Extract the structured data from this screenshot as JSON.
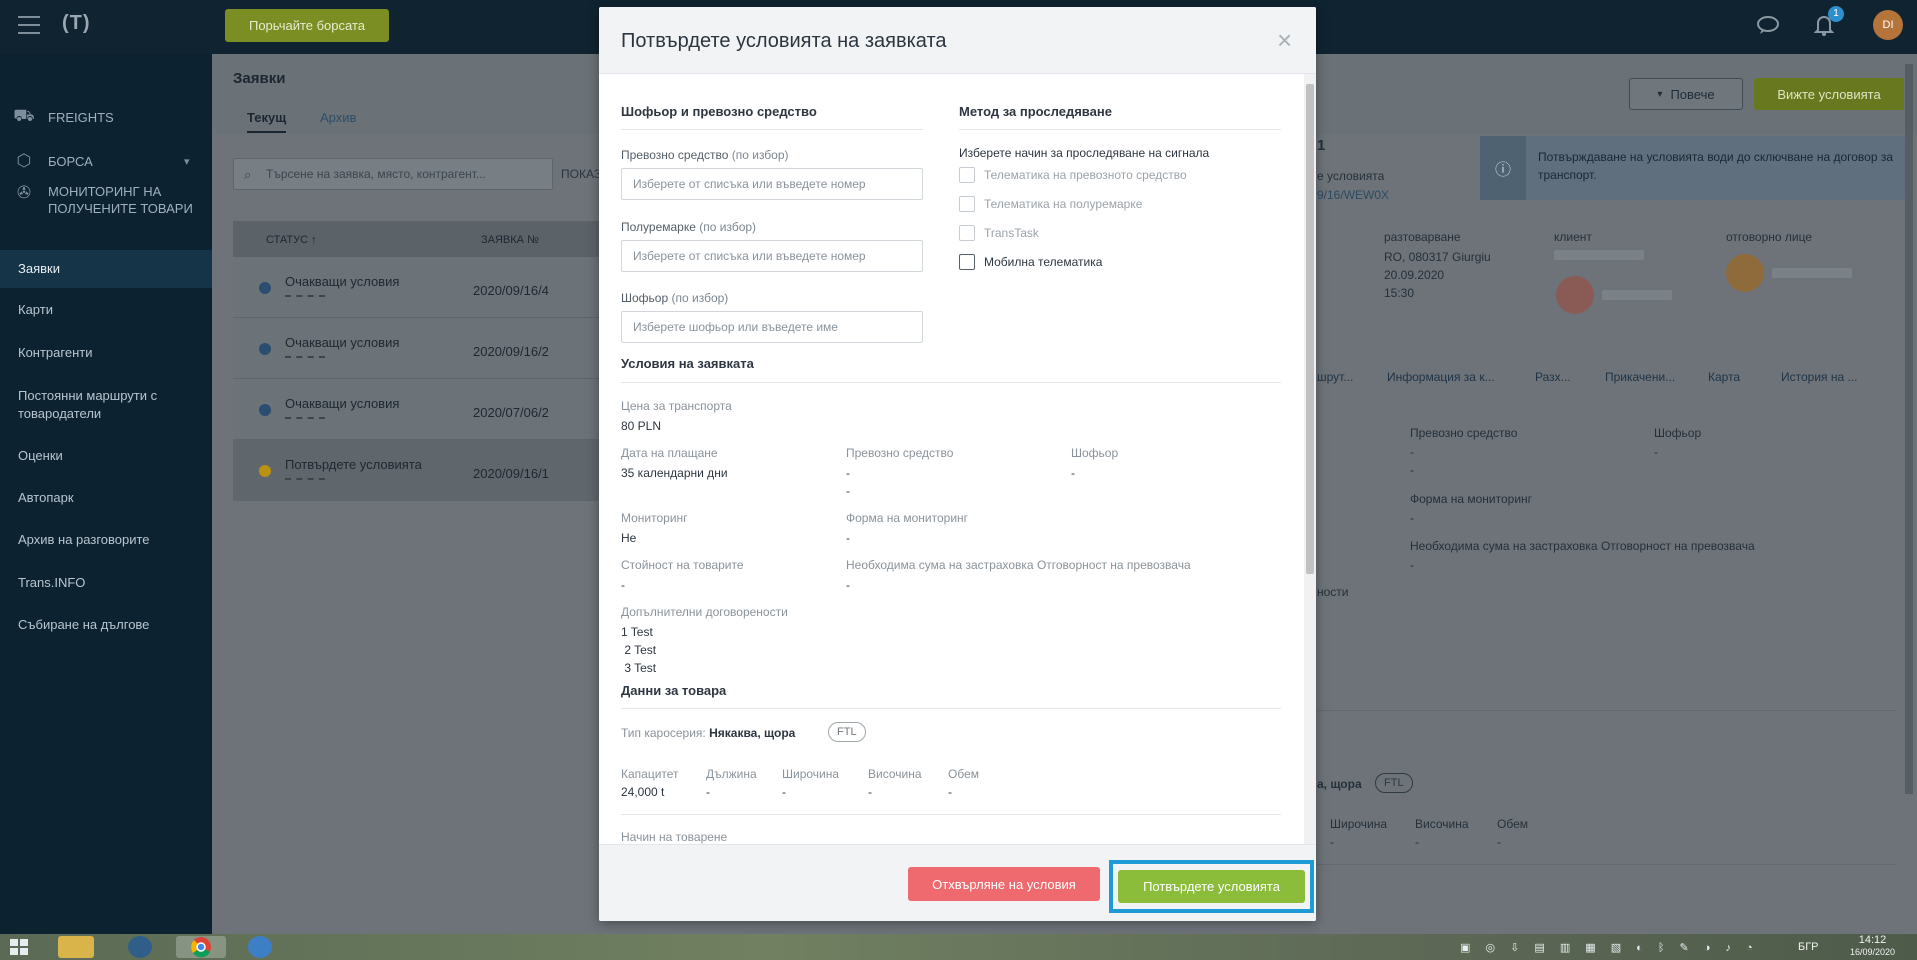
{
  "topbar": {
    "buy_label": "Порьчайте борсата",
    "notification_count": "1",
    "avatar_initials": "DI"
  },
  "sidebar": {
    "top_items": [
      {
        "label": "FREIGHTS",
        "icon": "freights-icon"
      },
      {
        "label": "БОРСА",
        "icon": "box-icon"
      },
      {
        "label": "МОНИТОРИНГ НА ПОЛУЧЕНИТЕ ТОВАРИ",
        "icon": "monitoring-icon"
      }
    ],
    "items": [
      {
        "label": "Заявки",
        "active": true
      },
      {
        "label": "Карти"
      },
      {
        "label": "Контрагенти"
      },
      {
        "label": "Постоянни маршрути с товародатели"
      },
      {
        "label": "Оценки"
      },
      {
        "label": "Автопарк"
      },
      {
        "label": "Архив на разговорите"
      },
      {
        "label": "Trans.INFO"
      },
      {
        "label": "Събиране на дългове"
      }
    ]
  },
  "main": {
    "title": "Заявки",
    "tabs": [
      "Текущ",
      "Архив"
    ],
    "search_placeholder": "Търсене на заявка, място, контрагент...",
    "show_label": "ПОКАЗ",
    "columns": [
      "СТАТУС ↑",
      "ЗАЯВКА №"
    ],
    "rows": [
      {
        "status": "Очакващи условия",
        "number": "2020/09/16/4"
      },
      {
        "status": "Очакващи условия",
        "number": "2020/09/16/2"
      },
      {
        "status": "Очакващи условия",
        "number": "2020/07/06/2"
      },
      {
        "status": "Потвърдете условията",
        "number": "2020/09/16/1"
      }
    ],
    "more_label": "Повече",
    "view_label": "Вижте условията",
    "info_text": "Потвърждаване на условията води до сключване на договор за транспорт.",
    "detail_id": "1",
    "detail_status": "е условията",
    "detail_ref": "9/16/WEW0X",
    "col_unloading": "разтоварване",
    "unloading_place": "RO, 080317 Giurgiu",
    "unloading_date": "20.09.2020",
    "unloading_time": "15:30",
    "col_client": "клиент",
    "col_responsible": "отговорно лице",
    "detail_tabs": [
      "шрут...",
      "Информация за к...",
      "Разх...",
      "Прикачени...",
      "Карта",
      "История на ..."
    ],
    "bg_vehicle": "Превозно средство",
    "bg_driver": "Шофьор",
    "bg_form": "Форма на мониторинг",
    "bg_insurance": "Необходима сума на застраховка Отговорност на превозвача",
    "bg_nosti": "ности",
    "bg_body": "а, щора",
    "bg_ftl": "FTL",
    "bg_dims": [
      "Широчина",
      "Височина",
      "Обем"
    ],
    "dash": "-"
  },
  "modal": {
    "title": "Потвърдете условията на заявката",
    "driver_section": "Шофьор и превозно средство",
    "vehicle_label": "Превозно средство",
    "trailer_label": "Полуремарке",
    "driver_label": "Шофьор",
    "optional": "(по избор)",
    "vehicle_placeholder": "Изберете от списъка или въведете номер",
    "trailer_placeholder": "Изберете от списъка или въведете номер",
    "driver_placeholder": "Изберете шофьор или въведете име",
    "tracking_section": "Метод за проследяване",
    "tracking_hint": "Изберете начин за проследяване на сигнала",
    "tracking_options": [
      "Телематика на превозното средство",
      "Телематика на полуремарке",
      "TransTask",
      "Мобилна телематика"
    ],
    "conditions_section": "Условия на заявката",
    "price_label": "Цена за транспорта",
    "price_value": "80 PLN",
    "pay_label": "Дата на плащане",
    "pay_value": "35 календарни дни",
    "vehicle2_label": "Превозно средство",
    "driver2_label": "Шофьор",
    "monitoring_label": "Мониторинг",
    "monitoring_value": "Не",
    "monitoring_form_label": "Форма на мониторинг",
    "goods_value_label": "Стойност на товарите",
    "insurance_label": "Необходима сума на застраховка Отговорност на превозвача",
    "extra_label": "Допълнителни договорености",
    "extra_lines": [
      "1 Test",
      " 2 Test",
      " 3 Test"
    ],
    "goods_section": "Данни за товара",
    "body_type_label": "Тип каросерия:",
    "body_type_value": "Някаква, щора",
    "load_type": "FTL",
    "capacity_label": "Капацитет",
    "capacity_value": "24,000 t",
    "length_label": "Дължина",
    "width_label": "Широчина",
    "height_label": "Височина",
    "volume_label": "Обем",
    "loading_method_label": "Начин на товарене",
    "dash": "-",
    "reject_label": "Отхвърляне на условия",
    "confirm_label": "Потвърдете условията"
  },
  "taskbar": {
    "lang": "БГР",
    "time": "14:12",
    "date": "16/09/2020"
  }
}
